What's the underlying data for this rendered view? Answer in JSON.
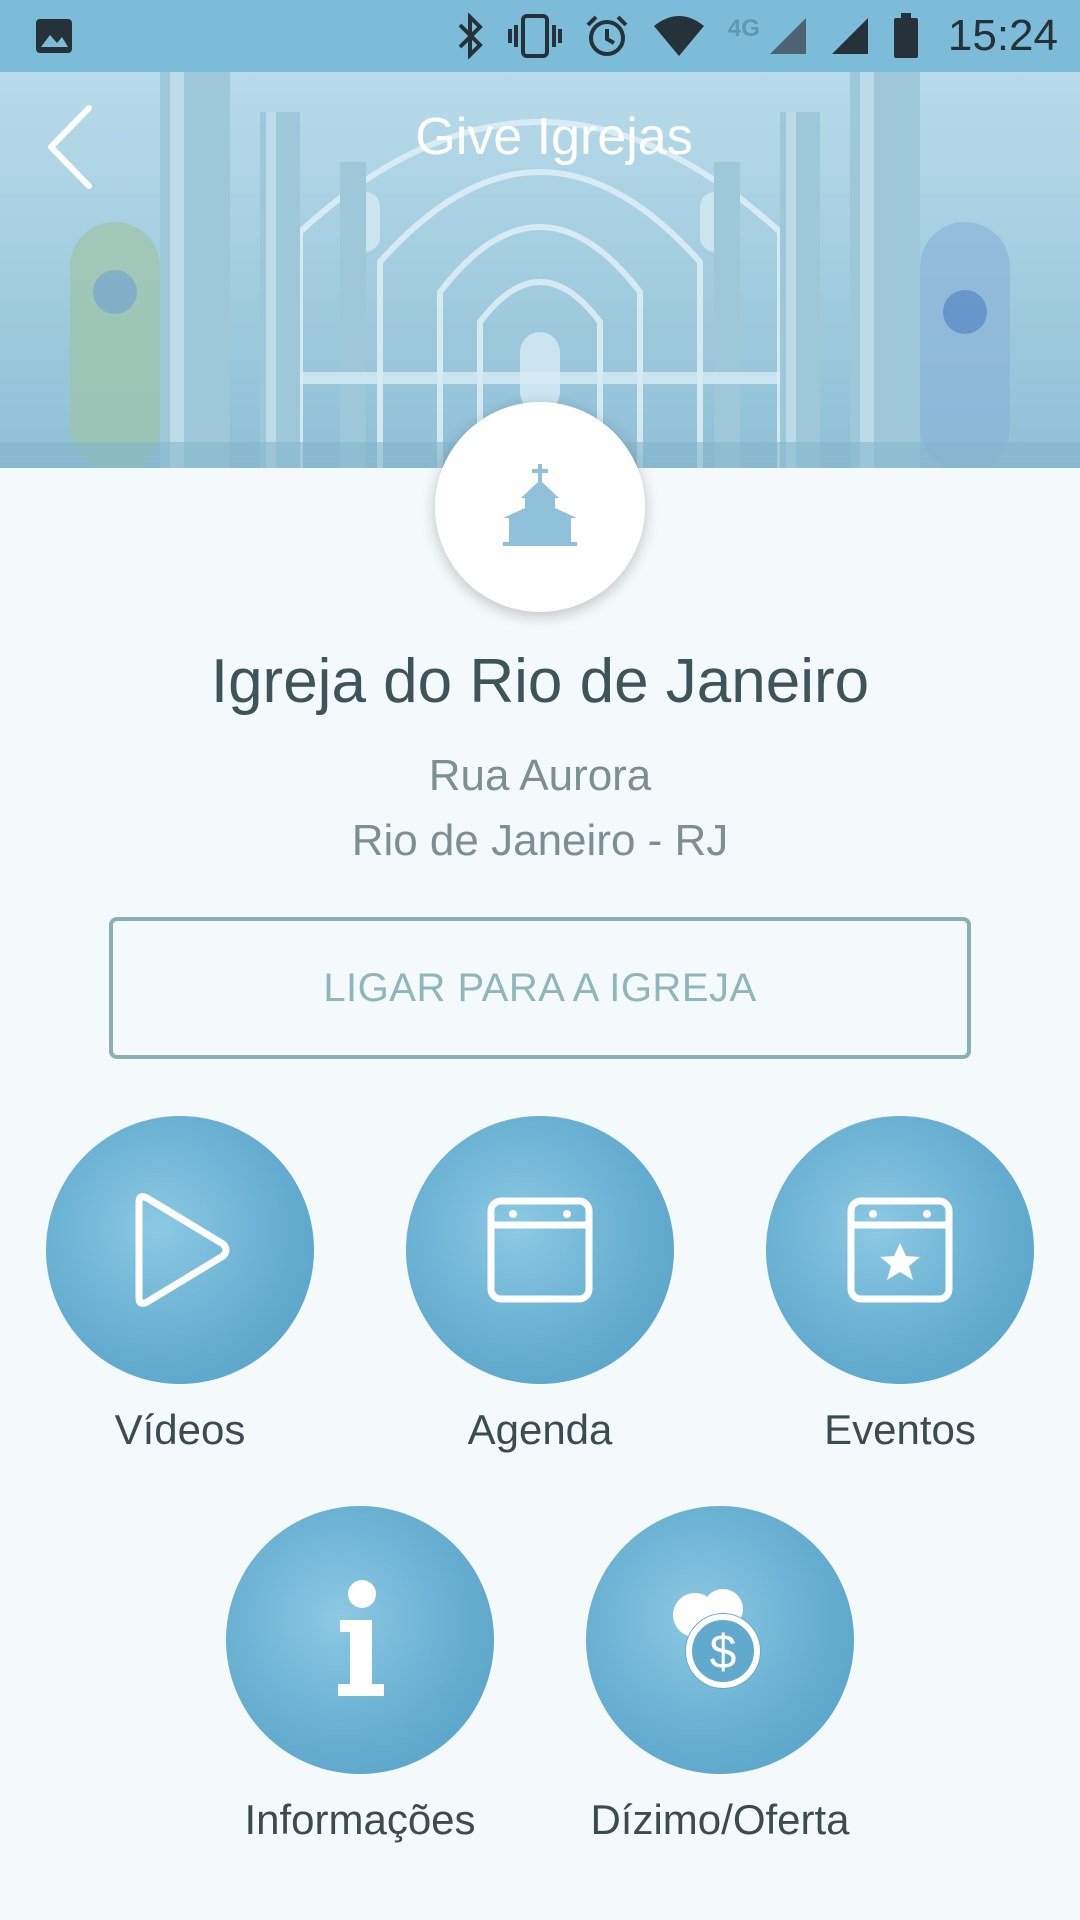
{
  "status_bar": {
    "time": "15:24",
    "network_label": "4G",
    "icons": [
      "image-icon",
      "bluetooth-icon",
      "vibrate-icon",
      "alarm-icon",
      "wifi-icon",
      "signal-icon",
      "signal-icon",
      "battery-icon"
    ]
  },
  "header": {
    "title": "Give Igrejas",
    "back_icon": "chevron-left-icon"
  },
  "church": {
    "name": "Igreja do Rio de Janeiro",
    "address_line1": "Rua Aurora",
    "address_line2": "Rio de Janeiro - RJ",
    "avatar_icon": "church-icon"
  },
  "call_button": {
    "label": "LIGAR PARA A IGREJA"
  },
  "actions": [
    {
      "label": "Vídeos",
      "icon": "play-icon"
    },
    {
      "label": "Agenda",
      "icon": "calendar-icon"
    },
    {
      "label": "Eventos",
      "icon": "calendar-star-icon"
    },
    {
      "label": "Informações",
      "icon": "info-icon"
    },
    {
      "label": "Dízimo/Oferta",
      "icon": "coins-dollar-icon"
    }
  ],
  "colors": {
    "status_bar": "#7cbcd9",
    "accent": "#6db3d4",
    "text_dark": "#3d5559",
    "text_muted": "#7c8f93",
    "button_border": "#89afb4"
  }
}
